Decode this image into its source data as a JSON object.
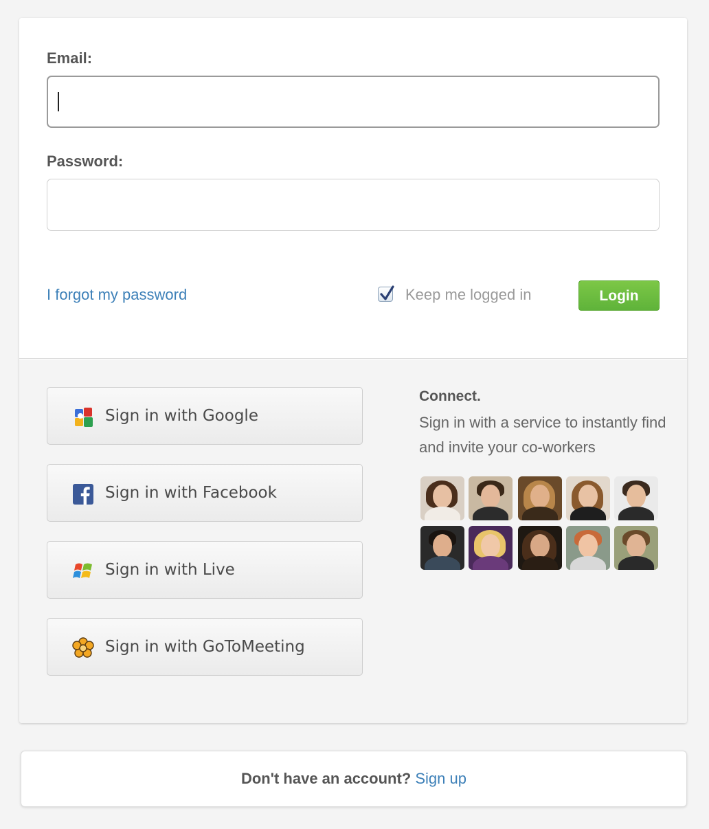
{
  "login": {
    "email_label": "Email:",
    "email_value": "",
    "password_label": "Password:",
    "password_value": "",
    "forgot_link": "I forgot my password",
    "keep_logged_in_label": "Keep me logged in",
    "keep_logged_in_checked": true,
    "login_button": "Login"
  },
  "social": {
    "buttons": [
      {
        "label": "Sign in with Google",
        "icon": "google-icon"
      },
      {
        "label": "Sign in with Facebook",
        "icon": "facebook-icon"
      },
      {
        "label": "Sign in with Live",
        "icon": "windows-live-icon"
      },
      {
        "label": "Sign in with GoToMeeting",
        "icon": "gotomeeting-icon"
      }
    ],
    "connect_title": "Connect.",
    "connect_description": "Sign in with a service to instantly find and invite your co-workers"
  },
  "signup": {
    "question": "Don't have an account?",
    "link": "Sign up"
  },
  "colors": {
    "link": "#3d80b8",
    "login_button": "#6cbd3f",
    "page_background": "#f4f4f4"
  }
}
